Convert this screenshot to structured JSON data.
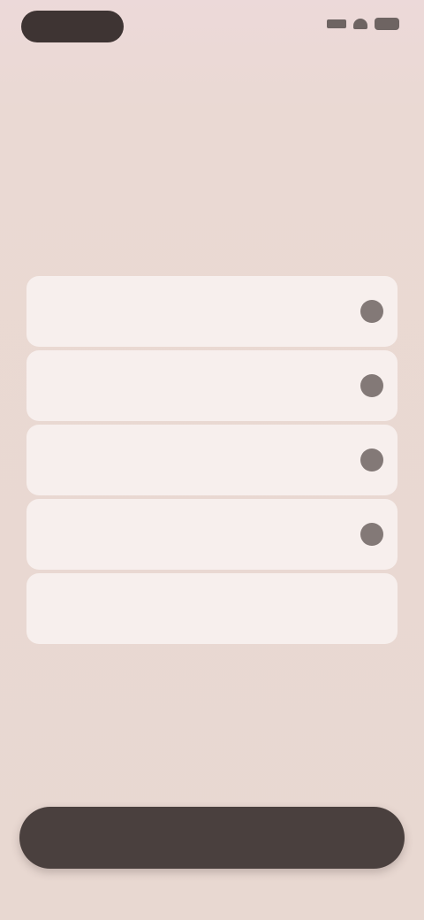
{
  "status_bar": {
    "time": ""
  },
  "header": {
    "skip_label": ""
  },
  "main": {
    "title": "",
    "subtitle": "",
    "options": [
      {
        "label": "",
        "icon": "radio-icon"
      },
      {
        "label": "",
        "icon": "radio-icon"
      },
      {
        "label": "",
        "icon": "radio-icon"
      },
      {
        "label": "",
        "icon": "radio-icon"
      },
      {
        "label": ""
      }
    ]
  },
  "footer": {
    "continue_label": ""
  },
  "colors": {
    "background": "#e8d8d1",
    "card": "#f8f1f0",
    "button": "#4a403e",
    "radio": "#837977",
    "title": "#3f3533"
  }
}
